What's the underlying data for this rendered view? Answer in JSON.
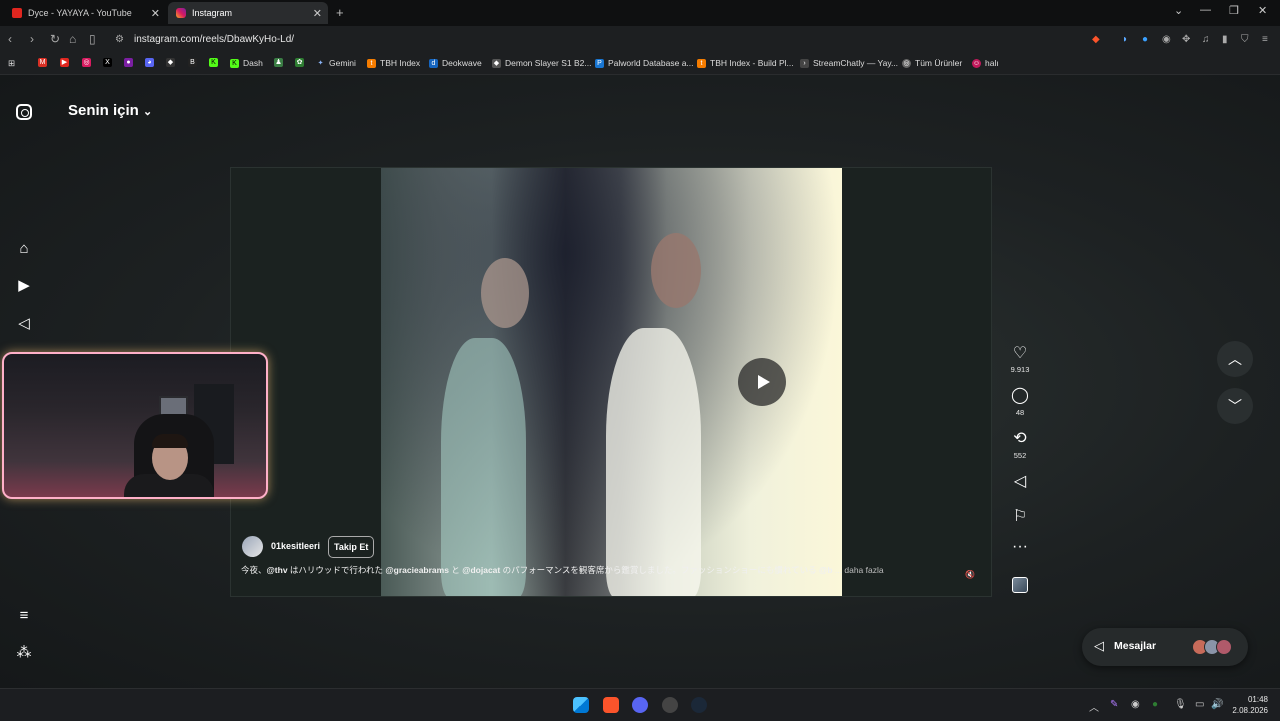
{
  "browser": {
    "tabs": [
      {
        "title": "Dyce - YAYAYA - YouTube",
        "active": false
      },
      {
        "title": "Instagram",
        "active": true
      }
    ],
    "url": "instagram.com/reels/DbawKyHo-Ld/",
    "bookmarks": [
      "Dash",
      "Gemini",
      "TBH Index",
      "Deokwave",
      "Demon Slayer S1 B2...",
      "Palworld Database a...",
      "TBH Index - Build Pl...",
      "StreamChatly — Yay...",
      "Tüm Ürünler",
      "halı"
    ],
    "bookmark_letters": {
      "b": "B"
    }
  },
  "instagram": {
    "feed_title": "Senin için",
    "reel": {
      "username": "01kesitleeri",
      "follow_label": "Takip Et",
      "caption_parts": {
        "p1": "今夜、",
        "m1": "@thv",
        "p2": " はハリウッドで行われた ",
        "m2": "@gracieabrams",
        "p3": " と ",
        "m3": "@dojacat",
        "p4": " のパフォーマンスを観客席から鑑賞しました。ファッションショーにも慣れている ",
        "m4": "@b",
        "p5": " ..."
      },
      "more_label": "daha fazla",
      "likes": "9.913",
      "comments": "48",
      "reposts": "552"
    },
    "messages_label": "Mesajlar"
  },
  "taskbar": {
    "time": "01:48",
    "date": "2.08.2026"
  },
  "colors": {
    "page_bg": "#1a1d1e",
    "cam_border": "#ffb0c8"
  }
}
